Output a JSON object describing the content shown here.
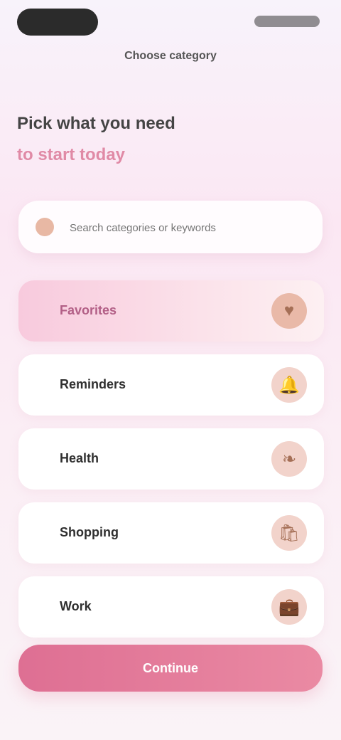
{
  "status_bar": {},
  "screen": {
    "title": "Choose category",
    "heading": {
      "line1": "Pick what you need",
      "line2": "to start today"
    },
    "search": {
      "placeholder": "Search categories or keywords"
    },
    "items": [
      {
        "label": "Favorites",
        "icon": "heart-icon",
        "glyph": "♥"
      },
      {
        "label": "Reminders",
        "icon": "bell-icon",
        "glyph": "🔔"
      },
      {
        "label": "Health",
        "icon": "leaf-icon",
        "glyph": "❧"
      },
      {
        "label": "Shopping",
        "icon": "bag-icon",
        "glyph": "🛍"
      },
      {
        "label": "Work",
        "icon": "briefcase-icon",
        "glyph": "💼"
      }
    ],
    "cta": "Continue"
  }
}
